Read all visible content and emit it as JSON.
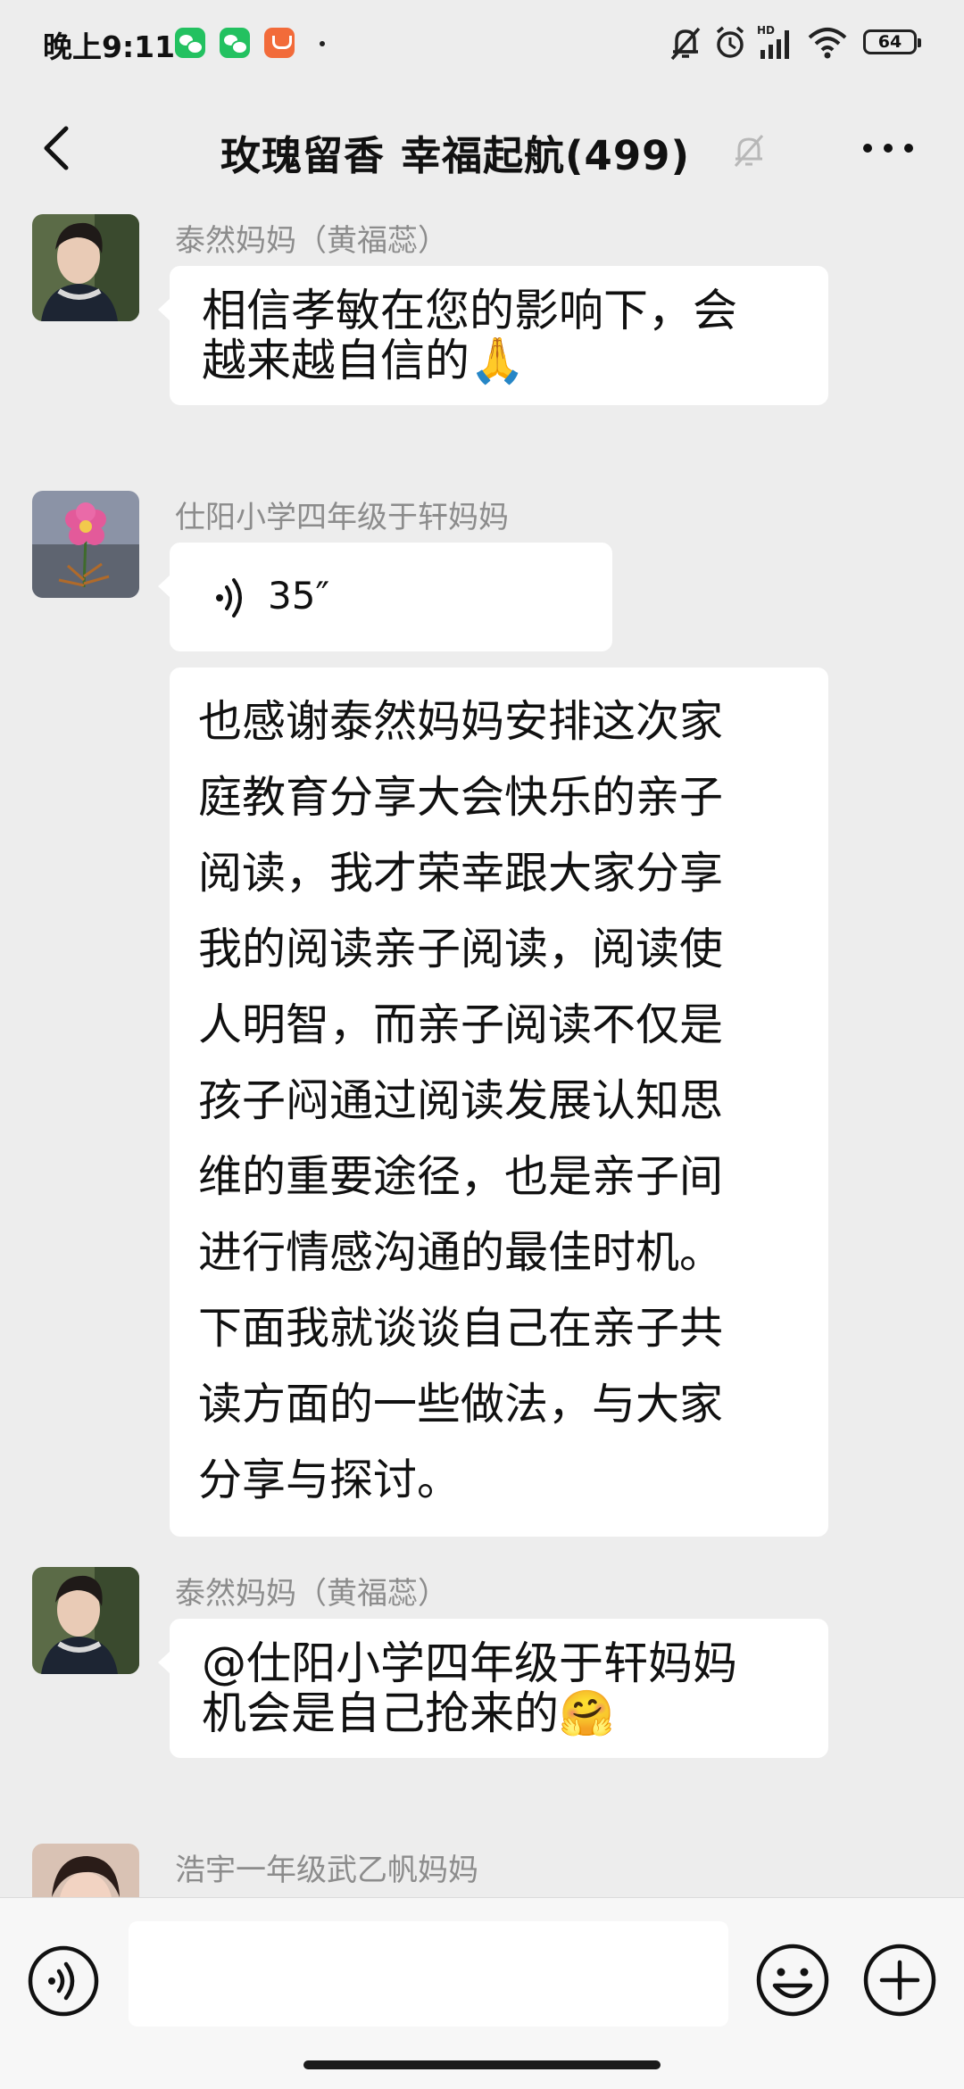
{
  "status_bar": {
    "time": "晚上9:11",
    "battery": "64",
    "icons": [
      "wechat-notification-icon",
      "wechat-notification-icon",
      "taobao-notification-icon",
      "dot-icon",
      "mute-icon",
      "alarm-icon",
      "hd-signal-icon",
      "wifi-icon",
      "battery-icon"
    ]
  },
  "header": {
    "title_part1": "玫瑰留香",
    "title_part2": "幸福起航(499)",
    "back_icon": "chevron-left-icon",
    "mute_icon": "bell-muted-icon",
    "more_icon": "more-dots-icon"
  },
  "messages": [
    {
      "sender": "泰然妈妈（黄福蕊）",
      "avatar": "avatar-woman",
      "lines": [
        "相信孝敏在您的影响下，会",
        "越来越自信的🙏"
      ]
    },
    {
      "sender": "仕阳小学四年级于轩妈妈",
      "avatar": "avatar-flower",
      "voice_duration": "35″",
      "lines": [
        "也感谢泰然妈妈安排这次家",
        "庭教育分享大会快乐的亲子",
        "阅读，我才荣幸跟大家分享",
        "我的阅读亲子阅读，阅读使",
        "人明智，而亲子阅读不仅是",
        "孩子闷通过阅读发展认知思",
        "维的重要途径，也是亲子间",
        "进行情感沟通的最佳时机。",
        "下面我就谈谈自己在亲子共",
        "读方面的一些做法，与大家",
        "分享与探讨。"
      ]
    },
    {
      "sender": "泰然妈妈（黄福蕊）",
      "avatar": "avatar-woman",
      "lines": [
        "@仕阳小学四年级于轩妈妈",
        " 机会是自己抢来的🤗"
      ]
    },
    {
      "sender": "浩宇一年级武乙帆妈妈",
      "avatar": "avatar-girl"
    }
  ],
  "input_bar": {
    "voice_icon": "voice-input-icon",
    "text_value": "",
    "emoji_icon": "emoji-icon",
    "plus_icon": "plus-icon"
  },
  "colors": {
    "background": "#ededed",
    "bubble": "#ffffff",
    "sender_name": "#8c8c8c",
    "input_bar": "#f7f7f7"
  }
}
